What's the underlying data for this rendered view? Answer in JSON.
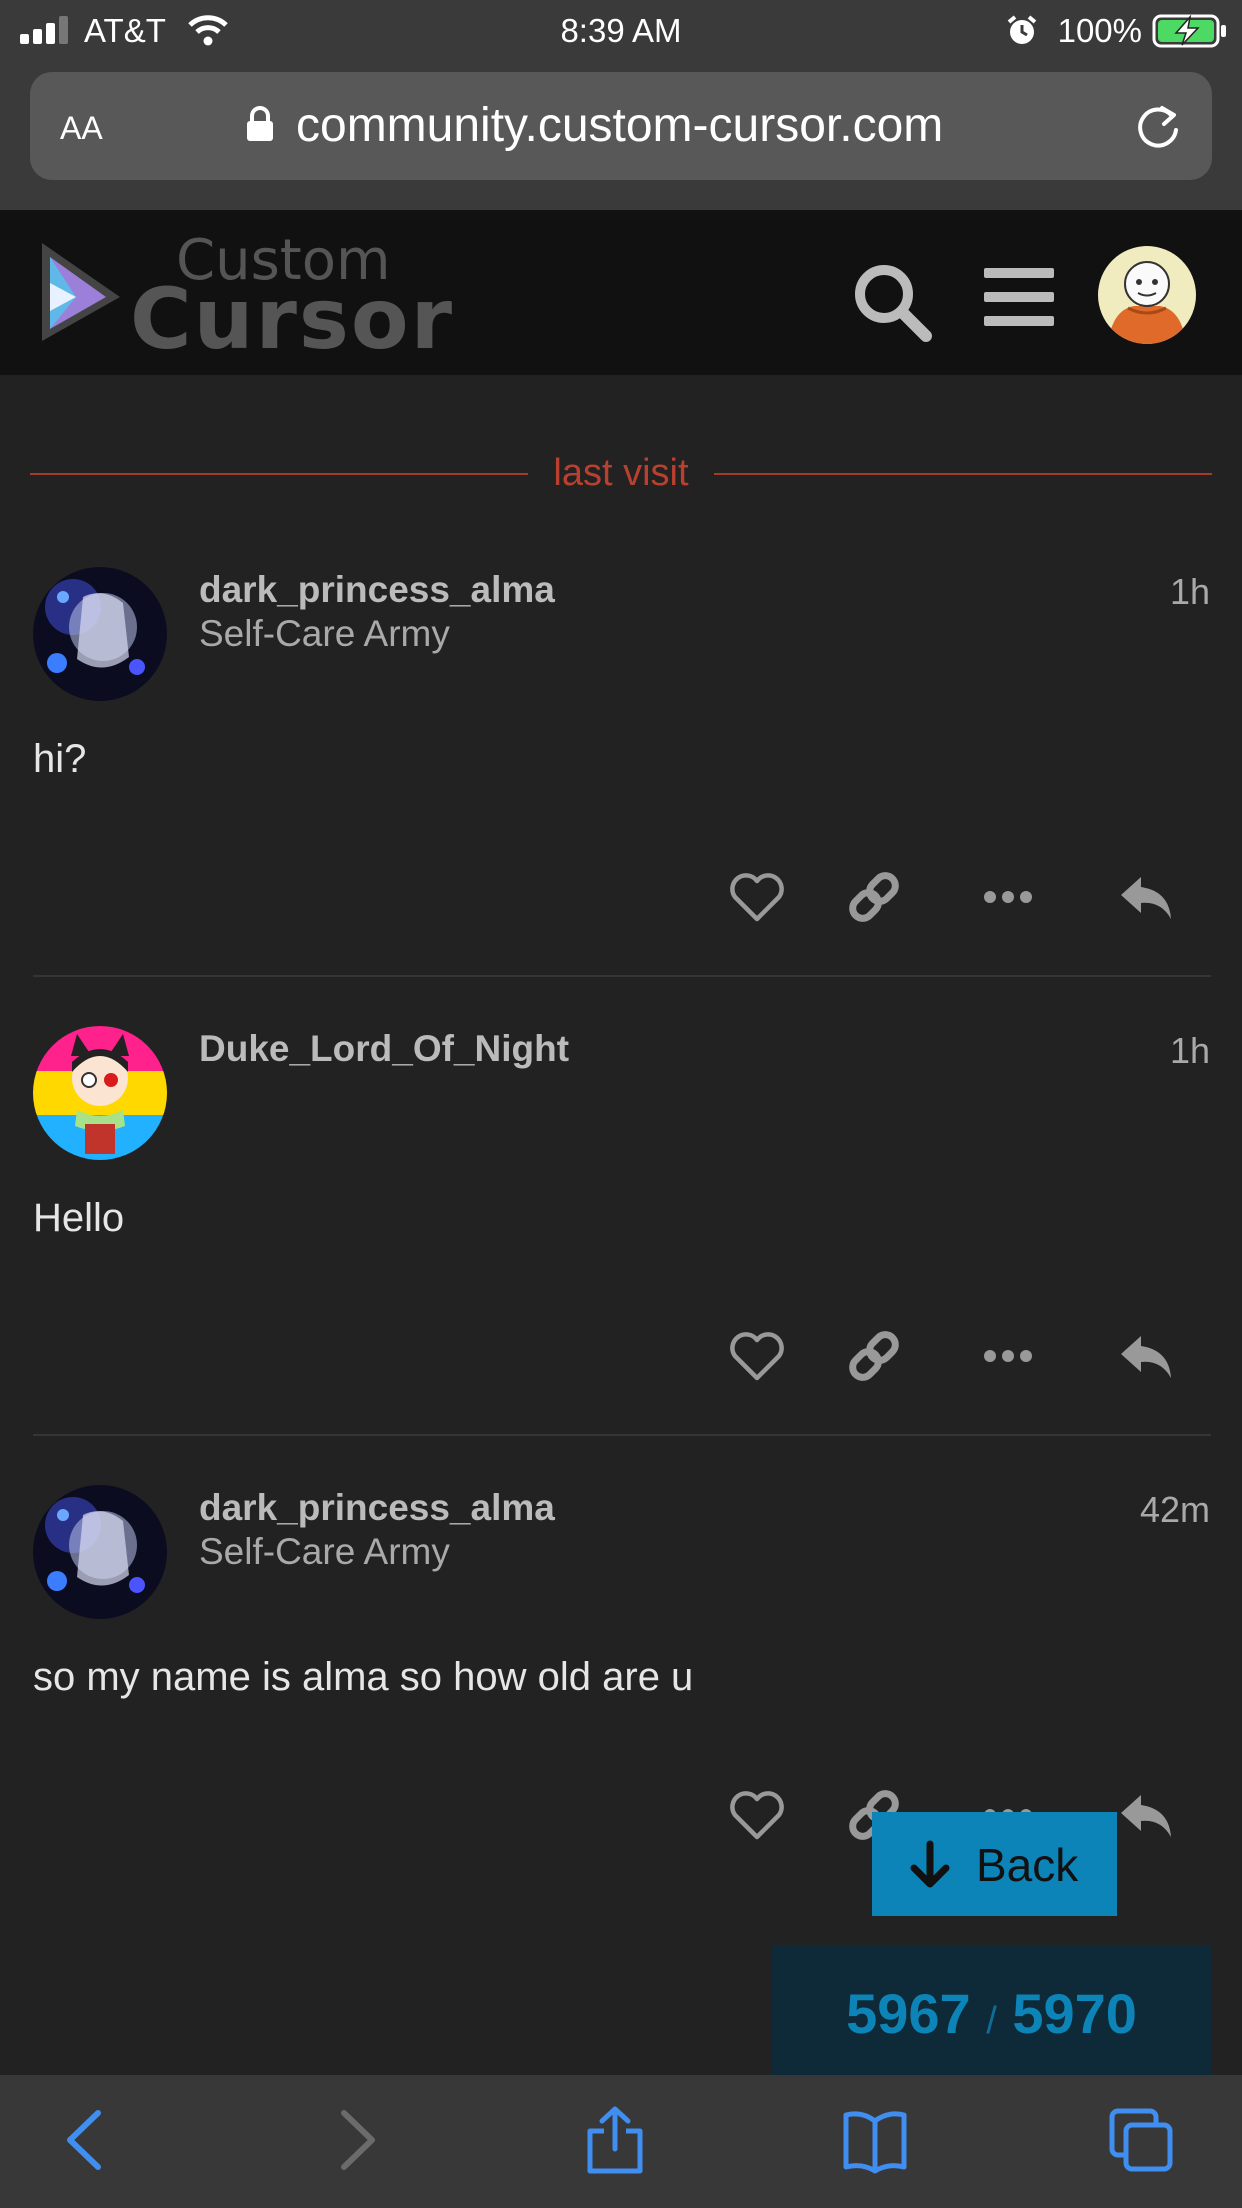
{
  "status_bar": {
    "carrier": "AT&T",
    "time": "8:39 AM",
    "battery": "100%"
  },
  "browser": {
    "text_size_label": "AA",
    "url": "community.custom-cursor.com"
  },
  "site_header": {
    "logo_line1": "Custom",
    "logo_line2": "Cursor"
  },
  "divider": {
    "label": "last visit"
  },
  "posts": [
    {
      "username": "dark_princess_alma",
      "user_title": "Self-Care Army",
      "age": "1h",
      "body": "hi?"
    },
    {
      "username": "Duke_Lord_Of_Night",
      "user_title": "",
      "age": "1h",
      "body": "Hello"
    },
    {
      "username": "dark_princess_alma",
      "user_title": "Self-Care Army",
      "age": "42m",
      "body": "so my name is alma so how old are u"
    }
  ],
  "back_button": {
    "label": "Back"
  },
  "progress": {
    "current": "5967",
    "separator": "/",
    "total": "5970"
  },
  "colors": {
    "accent": "#0d84b8",
    "last_visit": "#b9402e",
    "background": "#222222"
  }
}
